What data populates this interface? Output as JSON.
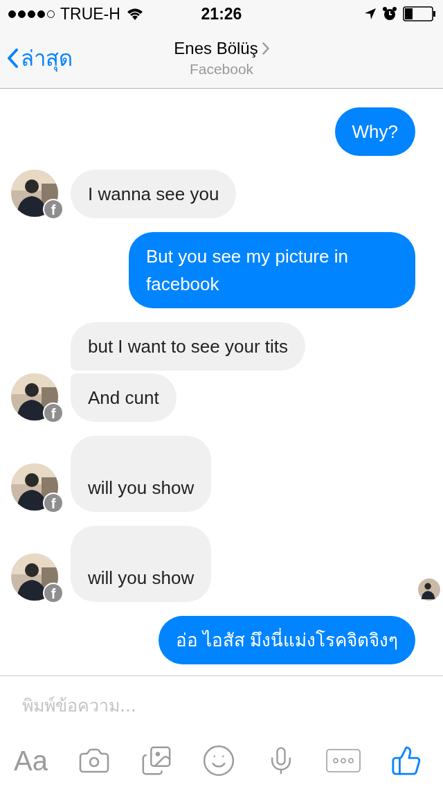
{
  "status_bar": {
    "carrier": "TRUE-H",
    "time": "21:26"
  },
  "nav": {
    "back_label": "ล่าสุด",
    "title": "Enes Bölüş",
    "subtitle": "Facebook"
  },
  "messages": [
    {
      "kind": "outgoing",
      "text": "Why?"
    },
    {
      "kind": "incoming",
      "text": "I wanna see you",
      "avatar": true,
      "badge": "f"
    },
    {
      "kind": "outgoing",
      "text": "But you see my picture in facebook"
    },
    {
      "kind": "incoming",
      "text": "but I want to see your tits",
      "avatar": false,
      "group_start": true
    },
    {
      "kind": "incoming",
      "text": "And cunt",
      "avatar": true,
      "badge": "f",
      "group_end": true
    },
    {
      "kind": "incoming",
      "text": "will you show",
      "avatar": true,
      "badge": "f",
      "blank_line_before": true
    },
    {
      "kind": "incoming",
      "text": "will you show",
      "avatar": true,
      "badge": "f",
      "blank_line_before": true,
      "seen": true
    },
    {
      "kind": "outgoing",
      "text": "อ่อ ไอสัส มึงนี่แม่งโรคจิตจิงๆ"
    }
  ],
  "composer": {
    "placeholder": "พิมพ์ข้อความ...",
    "text_button": "Aa"
  }
}
